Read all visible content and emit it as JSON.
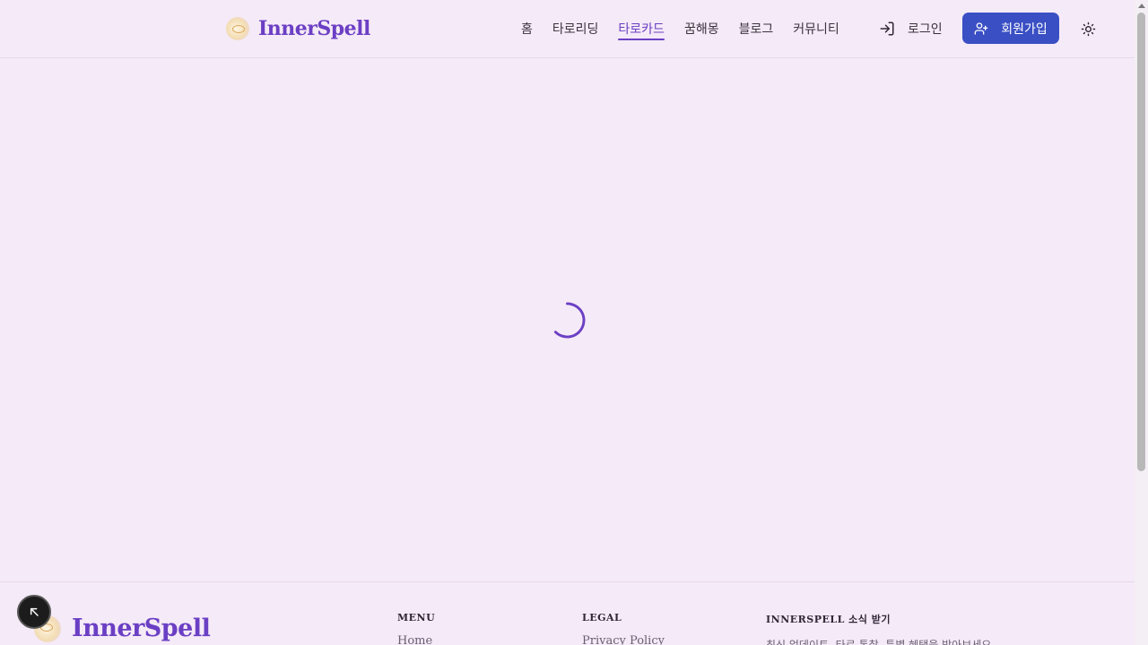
{
  "header": {
    "logo_text": "InnerSpell",
    "nav": [
      {
        "label": "홈",
        "active": false
      },
      {
        "label": "타로리딩",
        "active": false
      },
      {
        "label": "타로카드",
        "active": true
      },
      {
        "label": "꿈해몽",
        "active": false
      },
      {
        "label": "블로그",
        "active": false
      },
      {
        "label": "커뮤니티",
        "active": false
      }
    ],
    "login_label": "로그인",
    "signup_label": "회원가입",
    "theme_icon": "sun-icon"
  },
  "main": {
    "loading_icon": "spinner-icon"
  },
  "footer": {
    "logo_text": "InnerSpell",
    "menu_heading": "MENU",
    "menu_first_link": "Home",
    "legal_heading": "LEGAL",
    "legal_first_link": "Privacy Policy",
    "newsletter_heading": "INNERSPELL 소식 받기",
    "newsletter_text": "최신 업데이트, 타로 통찰, 특별 혜택을 받아보세요"
  },
  "floating_button_icon": "arrow-up-left-icon",
  "colors": {
    "background": "#f5eaf7",
    "accent": "#6b3fc4",
    "signup_button": "#3a4fc4"
  }
}
